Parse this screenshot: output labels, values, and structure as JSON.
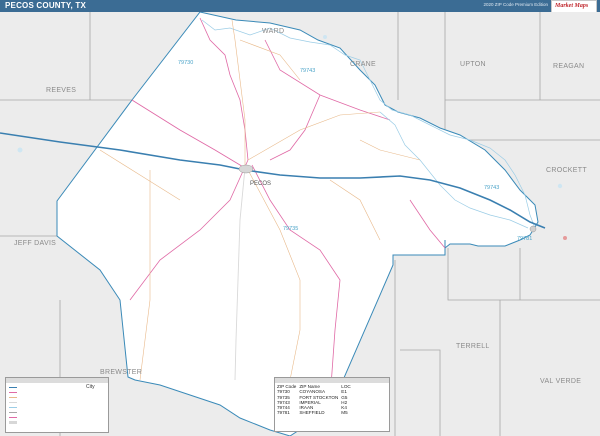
{
  "header": {
    "title": "PECOS COUNTY, TX",
    "subtitle": "2020 ZIP Code Premium Edition",
    "logo_text": "Market Maps"
  },
  "counties": {
    "ward": "WARD",
    "crane": "CRANE",
    "reeves": "REEVES",
    "upton": "UPTON",
    "reagan": "REAGAN",
    "crockett": "CROCKETT",
    "jeff_davis": "JEFF DAVIS",
    "brewster": "BREWSTER",
    "terrell": "TERRELL",
    "val_verde": "VAL VERDE"
  },
  "zip_labels": {
    "z79730": "79730",
    "z79743": "79743",
    "z79735": "79735",
    "z79743b": "79743",
    "z79781": "79781"
  },
  "places": {
    "pecos": "PECOS"
  },
  "legend": {
    "city_label": "City"
  },
  "zip_table": {
    "headers": [
      "ZIP Code",
      "ZIP Name",
      "LOC"
    ],
    "rows": [
      [
        "79730",
        "COYANOSA",
        "E1"
      ],
      [
        "79735",
        "FORT STOCKTON",
        "G5"
      ],
      [
        "79743",
        "IMPERIAL",
        "H2"
      ],
      [
        "79744",
        "IRAAN",
        "K4"
      ],
      [
        "79781",
        "SHEFFIELD",
        "M5"
      ]
    ]
  },
  "colors": {
    "header": "#3b6c94",
    "county_fill": "#ffffff",
    "surround_fill": "#ececec",
    "county_border": "#3a8ab8",
    "highway": "#3a7fb0",
    "zip_boundary": "#e06aa6",
    "roads": "#e8b98a",
    "rivers": "#9ccde6",
    "logo_red": "#c0272d"
  }
}
